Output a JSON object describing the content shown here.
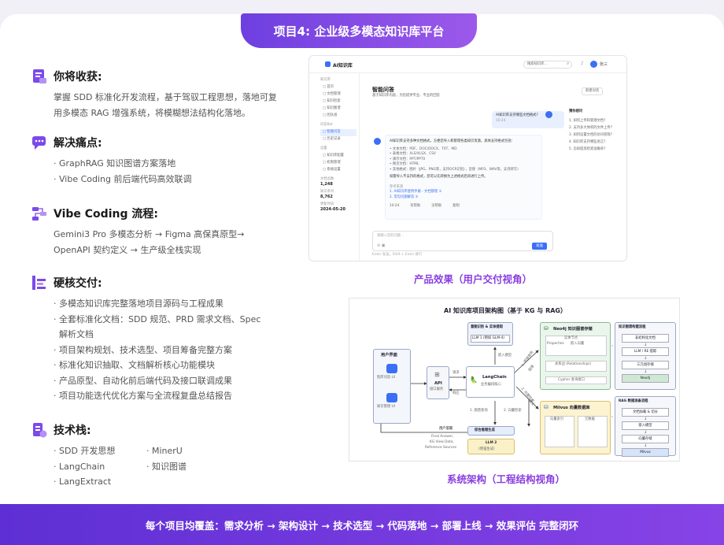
{
  "header": {
    "title": "项目4: 企业级多模态知识库平台"
  },
  "sections": {
    "gain": {
      "title": "你将收获:",
      "text": "掌握 SDD 标准化开发流程，基于驾驭工程思想，落地可复用多模态 RAG 增强系统，将模糊想法结构化落地。"
    },
    "pain": {
      "title": "解决痛点:",
      "items": [
        "· GraphRAG 知识图谱方案落地",
        "· Vibe Coding 前后端代码高效联调"
      ]
    },
    "flow": {
      "title": "Vibe Coding 流程:",
      "lines": [
        "Gemini3 Pro 多模态分析 → Figma 高保真原型→",
        "OpenAPI 契约定义 → 生产级全栈实现"
      ]
    },
    "deliver": {
      "title": "硬核交付:",
      "items": [
        "· 多模态知识库完整落地项目源码与工程成果",
        "· 全套标准化文档：SDD 规范、PRD 需求文档、Spec",
        "  解析文档",
        "· 项目架构规划、技术选型、项目筹备完整方案",
        "· 标准化知识抽取、文档解析核心功能模块",
        "· 产品原型、自动化前后端代码及接口联调成果",
        "· 项目功能迭代优化方案与全流程复盘总结报告"
      ]
    },
    "stack": {
      "title": "技术栈:",
      "col1": [
        "· SDD 开发思想",
        "· LangChain",
        "· LangExtract"
      ],
      "col2": [
        "· MinerU",
        "· 知识图谱"
      ]
    }
  },
  "product": {
    "caption": "产品效果（用户交付视角）",
    "app_name": "AI知识库",
    "search_placeholder": "搜索知识库...",
    "user": "张三",
    "page_title": "智能问答",
    "page_sub": "基于知识库内容，为您提供专业、专业的回答",
    "new_chat": "新建对话",
    "nav": [
      {
        "group": "知识库",
        "items": [
          "首页",
          "文档管理",
          "知识检索",
          "知识图谱",
          "团队组"
        ]
      },
      {
        "group": "问答Bot",
        "items": [
          "智能问答",
          "历史记录"
        ]
      },
      {
        "group": "设置",
        "items": [
          "知识库配置",
          "权限管理",
          "系统设置"
        ]
      }
    ],
    "stats": [
      {
        "k": "文档总数",
        "v": "1,248"
      },
      {
        "k": "知识条目",
        "v": "8,762"
      },
      {
        "k": "更新时间",
        "v": "2024-05-20"
      }
    ],
    "user_msg": "AI知识库支持哪些文档格式?",
    "user_time": "10:24",
    "bot_intro": "AI知识库支持多种文档格式，方便您导入和管理各类知识资源。具体支持格式包括：",
    "bot_items": [
      "• 文本文档：PDF、DOC/DOCX、TXT、MD",
      "• 表格文档：XLS/XLSX、CSV",
      "• 演示文档：PPT/PPTX",
      "• 网页文档：HTML",
      "• 其他格式：图片（JPG、PNG等，支持OCR识别），音频（MP3、WAV等，支持转写）"
    ],
    "bot_outro": "如需导入不支持的格式，您可以先转换为上述格式后再进行上传。",
    "refs_title": "参考来源",
    "refs": [
      "1. AI知识库使用手册 - 文档管理 ①",
      "2. 常见问题解答 ②"
    ],
    "bot_actions": [
      "10:24",
      "有帮助",
      "没帮助",
      "复制"
    ],
    "suggest_title": "猜你想问",
    "suggest": [
      "1. 如何上传和管理文档?",
      "2. 支持多大体积的文件上传?",
      "3. 如何设置文档的访问权限?",
      "4. 知识库支持哪些语言?",
      "5. 怎样提高检索准确率?"
    ],
    "input_placeholder": "请输入您的问题...",
    "send": "发送",
    "footer_hint": "Enter 发送，Shift + Enter 换行"
  },
  "architecture": {
    "caption": "系统架构（工程结构视角）",
    "title": "AI 知识库项目架构图（基于 KG 与 RAG）",
    "ui_box": {
      "title": "用户界面",
      "a": "智库问答 UI",
      "b": "知识管理 UI"
    },
    "api": {
      "title": "API",
      "sub": "接口服务"
    },
    "intent": {
      "title": "意图识别 & 实体提取",
      "llm": "LLM 1 (例如 GLM-4)"
    },
    "lc": {
      "title": "LangChain",
      "sub": "业务编排核心"
    },
    "neo": {
      "title": "Neo4j 知识图谱存储",
      "entity": "实体节点",
      "props": "Properties",
      "embed": "嵌入向量",
      "rel": "关系边 (Relationships)",
      "cypher": "Cypher 查询接口"
    },
    "milvus": {
      "title": "Milvus 向量数据库",
      "c1": "向量索引",
      "c2": "元数据"
    },
    "syn": {
      "a": "综合推理生成",
      "llm": "LLM 2",
      "llm2": "(增强生成)"
    },
    "kg_flow": {
      "title": "知识图谱构建流程",
      "steps": [
        "非结构化文档",
        "LLM / RE 提取",
        "三元组存储",
        "Neo4j"
      ]
    },
    "rag_flow": {
      "title": "RAG 数据准备流程",
      "steps": [
        "文档加载 & 切分",
        "嵌入模型",
        "向量存储",
        "Milvus"
      ]
    },
    "labels": {
      "req": "请求",
      "resp": "响应",
      "embed": "嵌入模型",
      "graph_q": "1. 图谱查询",
      "vec_q": "2. 向量检索",
      "ans": "用户答案",
      "final": "Final Answer,",
      "kgv": "KG View Data,",
      "ref": "Reference Sources",
      "r1": "1. 图谱查询",
      "r2": "图谱",
      "r3": "2. 向量检索",
      "r4": "语义"
    }
  },
  "footer": {
    "text": "每个项目均覆盖：需求分析 → 架构设计 → 技术选型 → 代码落地 → 部署上线 → 效果评估 完整闭环"
  },
  "colors": {
    "accent": "#8a3fe0",
    "tab": "#7b46e6",
    "icon": "#7c4ae8"
  }
}
